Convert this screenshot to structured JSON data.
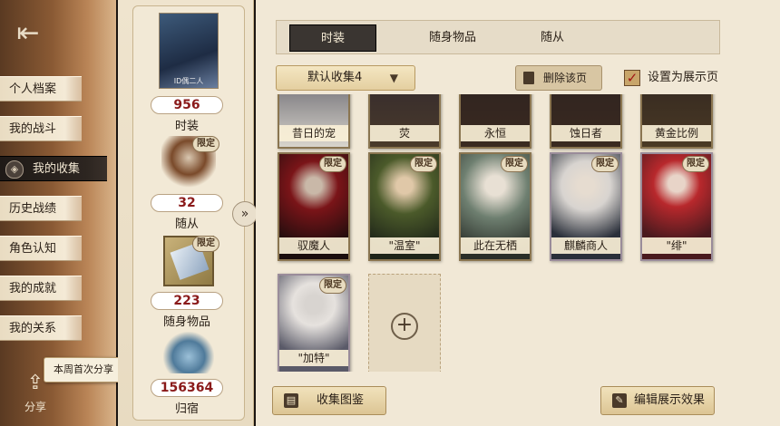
{
  "left_nav": {
    "items": [
      {
        "label": "个人档案"
      },
      {
        "label": "我的战斗"
      },
      {
        "label": "我的收集"
      },
      {
        "label": "历史战绩"
      },
      {
        "label": "角色认知"
      },
      {
        "label": "我的成就"
      },
      {
        "label": "我的关系"
      }
    ],
    "active_index": 2,
    "share_tip": "本周首次分享",
    "share_label": "分享"
  },
  "summary": {
    "top_thumb_caption": "ID偶二人",
    "costume": {
      "count": "956",
      "label": "时装"
    },
    "follower": {
      "count": "32",
      "label": "随从",
      "tag": "限定"
    },
    "accessory": {
      "count": "223",
      "label": "随身物品",
      "tag": "限定"
    },
    "home": {
      "count": "156364",
      "label": "归宿"
    }
  },
  "tabs": [
    {
      "label": "时装",
      "active": true
    },
    {
      "label": "随身物品",
      "active": false
    },
    {
      "label": "随从",
      "active": false
    }
  ],
  "toolbar": {
    "collection_select": "默认收集4",
    "delete_page": "删除该页",
    "set_display": "设置为展示页"
  },
  "cards_row0": [
    {
      "name": "昔日的宠"
    },
    {
      "name": "荧"
    },
    {
      "name": "永恒"
    },
    {
      "name": "蚀日者"
    },
    {
      "name": "黄金比例"
    }
  ],
  "cards_row1": [
    {
      "name": "驭魔人",
      "tag": "限定",
      "color": "#7a1418"
    },
    {
      "name": "\"温室\"",
      "tag": "限定",
      "color": "#4b5a2a"
    },
    {
      "name": "此在无栖",
      "tag": "限定",
      "color": "#6e7f70"
    },
    {
      "name": "麒麟商人",
      "tag": "限定",
      "color": "#2a2f3a"
    },
    {
      "name": "\"绯\"",
      "tag": "限定",
      "color": "#4a1a1e"
    }
  ],
  "cards_row2": [
    {
      "name": "\"加特\"",
      "tag": "限定",
      "color": "#5a5a68"
    }
  ],
  "bottom": {
    "atlas": "收集图鉴",
    "edit_display": "编辑展示效果"
  }
}
